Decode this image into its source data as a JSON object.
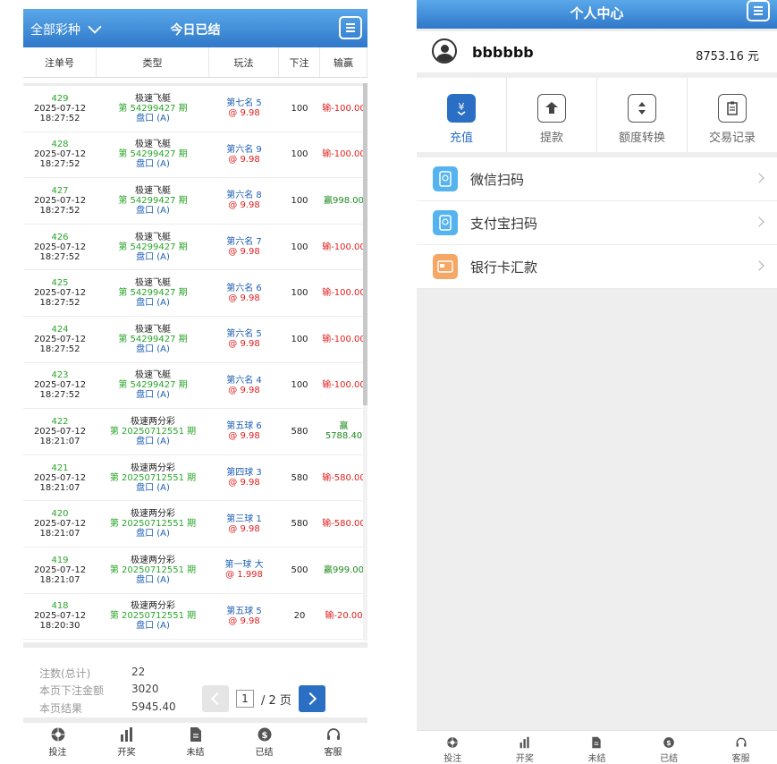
{
  "left": {
    "header": {
      "lottery_selector": "全部彩种",
      "title": "今日已结"
    },
    "columns": [
      "注单号",
      "类型",
      "玩法",
      "下注",
      "输赢"
    ],
    "rows": [
      {
        "id": "429",
        "date": "2025-07-12",
        "time": "18:27:52",
        "game": "极速飞艇",
        "issue": "第 54299427 期",
        "pan": "盘口 (A)",
        "play": "第七名 5",
        "odds": "@ 9.98",
        "stake": "100",
        "result_prefix": "输",
        "result": "-100.00",
        "win": false
      },
      {
        "id": "428",
        "date": "2025-07-12",
        "time": "18:27:52",
        "game": "极速飞艇",
        "issue": "第 54299427 期",
        "pan": "盘口 (A)",
        "play": "第六名 9",
        "odds": "@ 9.98",
        "stake": "100",
        "result_prefix": "输",
        "result": "-100.00",
        "win": false
      },
      {
        "id": "427",
        "date": "2025-07-12",
        "time": "18:27:52",
        "game": "极速飞艇",
        "issue": "第 54299427 期",
        "pan": "盘口 (A)",
        "play": "第六名 8",
        "odds": "@ 9.98",
        "stake": "100",
        "result_prefix": "赢",
        "result": "998.00",
        "win": true
      },
      {
        "id": "426",
        "date": "2025-07-12",
        "time": "18:27:52",
        "game": "极速飞艇",
        "issue": "第 54299427 期",
        "pan": "盘口 (A)",
        "play": "第六名 7",
        "odds": "@ 9.98",
        "stake": "100",
        "result_prefix": "输",
        "result": "-100.00",
        "win": false
      },
      {
        "id": "425",
        "date": "2025-07-12",
        "time": "18:27:52",
        "game": "极速飞艇",
        "issue": "第 54299427 期",
        "pan": "盘口 (A)",
        "play": "第六名 6",
        "odds": "@ 9.98",
        "stake": "100",
        "result_prefix": "输",
        "result": "-100.00",
        "win": false
      },
      {
        "id": "424",
        "date": "2025-07-12",
        "time": "18:27:52",
        "game": "极速飞艇",
        "issue": "第 54299427 期",
        "pan": "盘口 (A)",
        "play": "第六名 5",
        "odds": "@ 9.98",
        "stake": "100",
        "result_prefix": "输",
        "result": "-100.00",
        "win": false
      },
      {
        "id": "423",
        "date": "2025-07-12",
        "time": "18:27:52",
        "game": "极速飞艇",
        "issue": "第 54299427 期",
        "pan": "盘口 (A)",
        "play": "第六名 4",
        "odds": "@ 9.98",
        "stake": "100",
        "result_prefix": "输",
        "result": "-100.00",
        "win": false
      },
      {
        "id": "422",
        "date": "2025-07-12",
        "time": "18:21:07",
        "game": "极速两分彩",
        "issue": "第 20250712551 期",
        "pan": "盘口 (A)",
        "play": "第五球 6",
        "odds": "@ 9.98",
        "stake": "580",
        "result_prefix": "赢",
        "result": "5788.40",
        "win": true,
        "stacked": true
      },
      {
        "id": "421",
        "date": "2025-07-12",
        "time": "18:21:07",
        "game": "极速两分彩",
        "issue": "第 20250712551 期",
        "pan": "盘口 (A)",
        "play": "第四球 3",
        "odds": "@ 9.98",
        "stake": "580",
        "result_prefix": "输",
        "result": "-580.00",
        "win": false
      },
      {
        "id": "420",
        "date": "2025-07-12",
        "time": "18:21:07",
        "game": "极速两分彩",
        "issue": "第 20250712551 期",
        "pan": "盘口 (A)",
        "play": "第三球 1",
        "odds": "@ 9.98",
        "stake": "580",
        "result_prefix": "输",
        "result": "-580.00",
        "win": false
      },
      {
        "id": "419",
        "date": "2025-07-12",
        "time": "18:21:07",
        "game": "极速两分彩",
        "issue": "第 20250712551 期",
        "pan": "盘口 (A)",
        "play": "第一球 大",
        "odds": "@ 1.998",
        "stake": "500",
        "result_prefix": "赢",
        "result": "999.00",
        "win": true
      },
      {
        "id": "418",
        "date": "2025-07-12",
        "time": "18:20:30",
        "game": "极速两分彩",
        "issue": "第 20250712551 期",
        "pan": "盘口 (A)",
        "play": "第五球 5",
        "odds": "@ 9.98",
        "stake": "20",
        "result_prefix": "输",
        "result": "-20.00",
        "win": false
      }
    ],
    "summary": {
      "count_label": "注数(总计)",
      "count_value": "22",
      "amount_label": "本页下注金额",
      "amount_value": "3020",
      "result_label": "本页结果",
      "result_value": "5945.40"
    },
    "pager": {
      "current": "1",
      "total_text": "/ 2 页"
    },
    "tabs": [
      "投注",
      "开奖",
      "未结",
      "已结",
      "客服"
    ]
  },
  "right": {
    "header": {
      "title": "个人中心"
    },
    "username": "bbbbbb",
    "balance": "8753.16 元",
    "actions": [
      "充值",
      "提款",
      "额度转换",
      "交易记录"
    ],
    "payments": [
      "微信扫码",
      "支付宝扫码",
      "银行卡汇款"
    ],
    "tabs": [
      "投注",
      "开奖",
      "未结",
      "已结",
      "客服"
    ]
  },
  "colors": {
    "brand_blue": "#2f78c9",
    "win_green": "#1f8a1f",
    "lose_red": "#e02020",
    "wechat": "#55b4f0",
    "alipay": "#55b4f0",
    "bank": "#f5a765"
  }
}
